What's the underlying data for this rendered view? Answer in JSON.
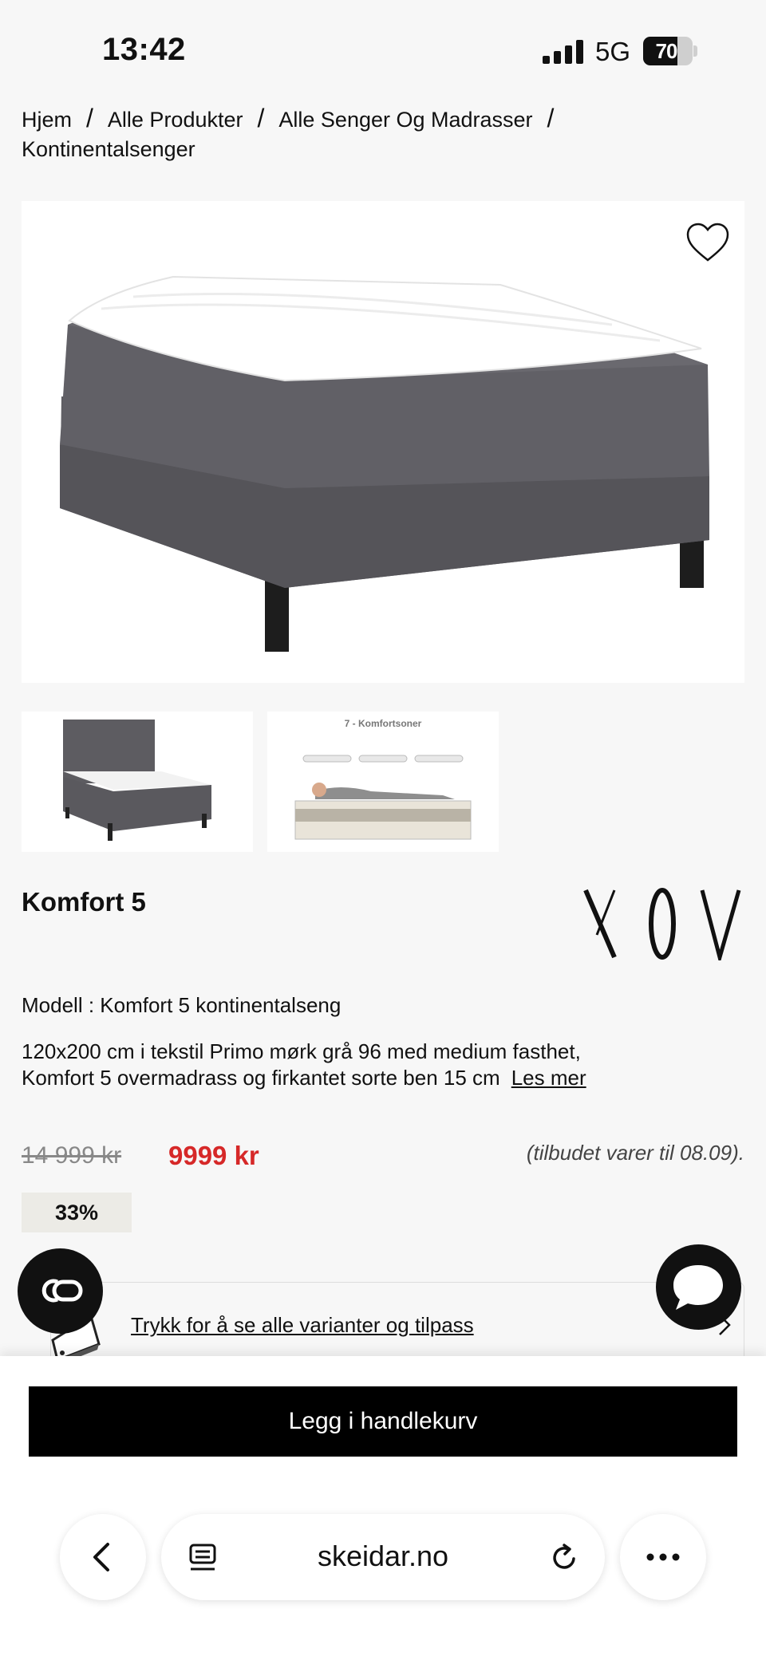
{
  "status_bar": {
    "time": "13:42",
    "network": "5G",
    "battery_percent": "70",
    "battery_level": 0.7
  },
  "breadcrumb": {
    "items": [
      "Hjem",
      "Alle Produkter",
      "Alle Senger Og Madrasser",
      "Kontinentalsenger"
    ],
    "separator": "/"
  },
  "gallery": {
    "thumb2_title": "7 - Komfortsoner"
  },
  "product": {
    "title": "Komfort 5",
    "model_line": "Modell : Komfort 5 kontinentalseng",
    "description": "120x200 cm i tekstil Primo mørk grå 96 med medium fasthet, Komfort 5 overmadrass og firkantet sorte ben 15 cm",
    "read_more": "Les mer",
    "old_price": "14 999 kr",
    "new_price": "9999 kr",
    "offer_note": "(tilbudet varer til 08.09).",
    "discount": "33%"
  },
  "variants": {
    "link_text": "Trykk for å se alle varianter og tilpass"
  },
  "cart": {
    "button_label": "Legg i handlekurv"
  },
  "browser": {
    "url": "skeidar.no"
  },
  "colors": {
    "price_red": "#d62828",
    "button_black": "#000000",
    "page_bg": "#f7f7f7",
    "discount_bg": "#ecebe6"
  },
  "icons": [
    "heart-icon",
    "co-icon",
    "chat-icon",
    "back-icon",
    "reader-icon",
    "reload-icon",
    "more-icon",
    "chevron-right-icon"
  ]
}
